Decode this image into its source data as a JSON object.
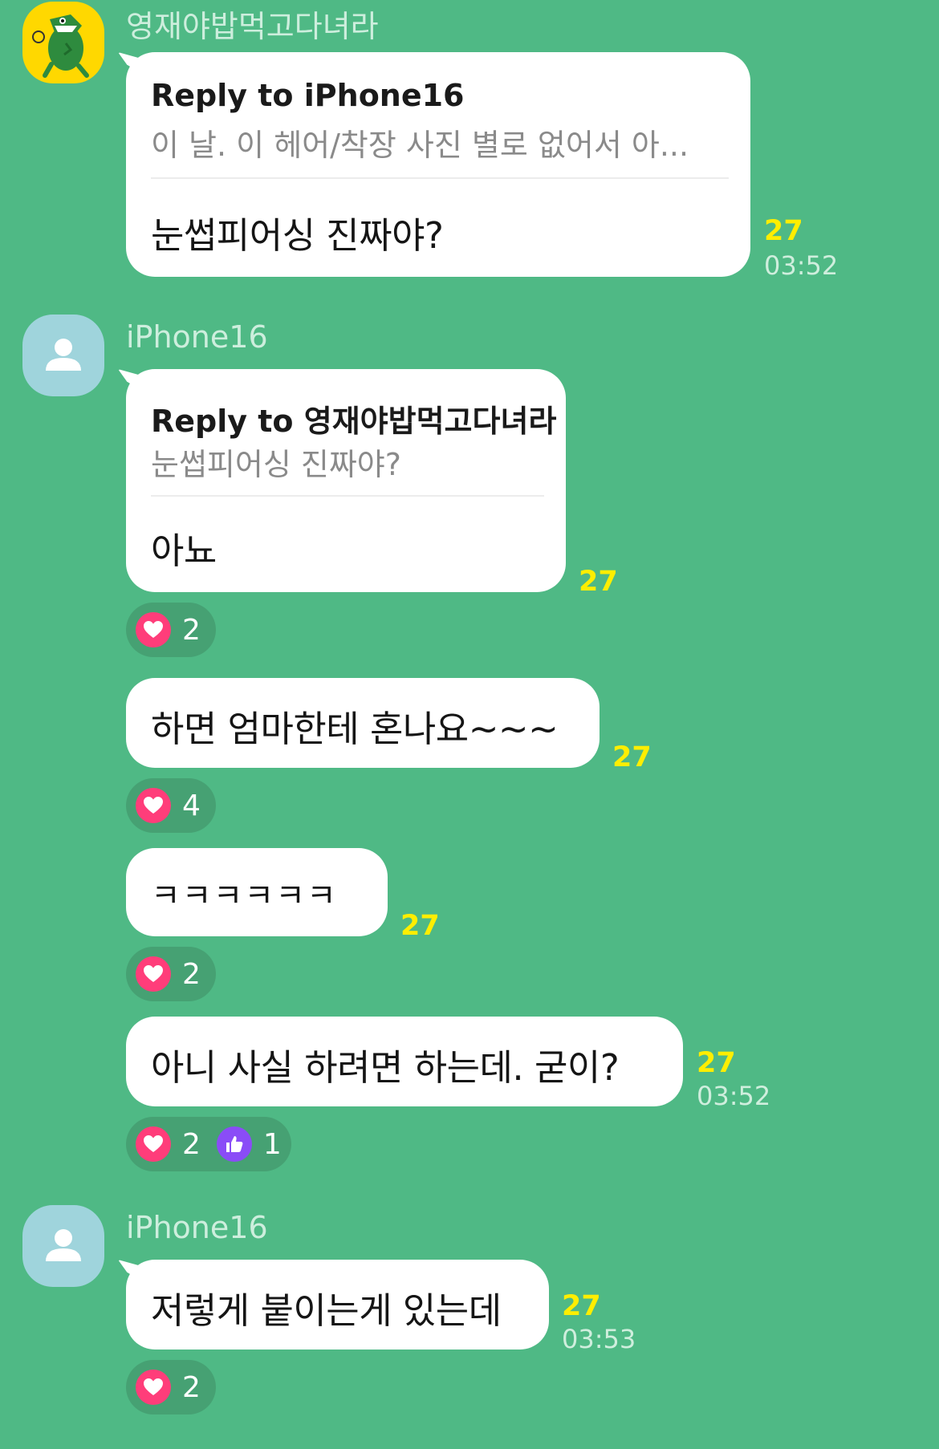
{
  "colors": {
    "chat_background": "#4fb985",
    "bubble": "#ffffff",
    "unread_count": "#ffee00",
    "heart_reaction": "#ff3d7a",
    "thumb_reaction": "#8a4cf7"
  },
  "groups": [
    {
      "sender": "영재야밥먹고다녀라",
      "avatar": "kakao-character-avatar",
      "messages": [
        {
          "reply_title": "Reply to iPhone16",
          "reply_preview": "이 날. 이 헤어/착장 사진 별로 없어서 아...",
          "text": "눈썹피어싱 진짜야?",
          "unread": "27",
          "time": "03:52"
        }
      ]
    },
    {
      "sender": "iPhone16",
      "avatar": "default-user-avatar",
      "messages": [
        {
          "reply_title": "Reply to 영재야밥먹고다녀라",
          "reply_preview": "눈썹피어싱 진짜야?",
          "text": "아뇨",
          "unread": "27",
          "reactions": [
            {
              "icon": "heart-icon",
              "count": "2"
            }
          ]
        },
        {
          "text": "하면 엄마한테 혼나요~~~",
          "unread": "27",
          "reactions": [
            {
              "icon": "heart-icon",
              "count": "4"
            }
          ]
        },
        {
          "text": "ㅋㅋㅋㅋㅋㅋ",
          "unread": "27",
          "reactions": [
            {
              "icon": "heart-icon",
              "count": "2"
            }
          ]
        },
        {
          "text": "아니 사실 하려면 하는데. 굳이?",
          "unread": "27",
          "time": "03:52",
          "reactions": [
            {
              "icon": "heart-icon",
              "count": "2"
            },
            {
              "icon": "thumbs-up-icon",
              "count": "1"
            }
          ]
        }
      ]
    },
    {
      "sender": "iPhone16",
      "avatar": "default-user-avatar",
      "messages": [
        {
          "text": "저렇게 붙이는게 있는데",
          "unread": "27",
          "time": "03:53",
          "reactions": [
            {
              "icon": "heart-icon",
              "count": "2"
            }
          ]
        }
      ]
    }
  ]
}
